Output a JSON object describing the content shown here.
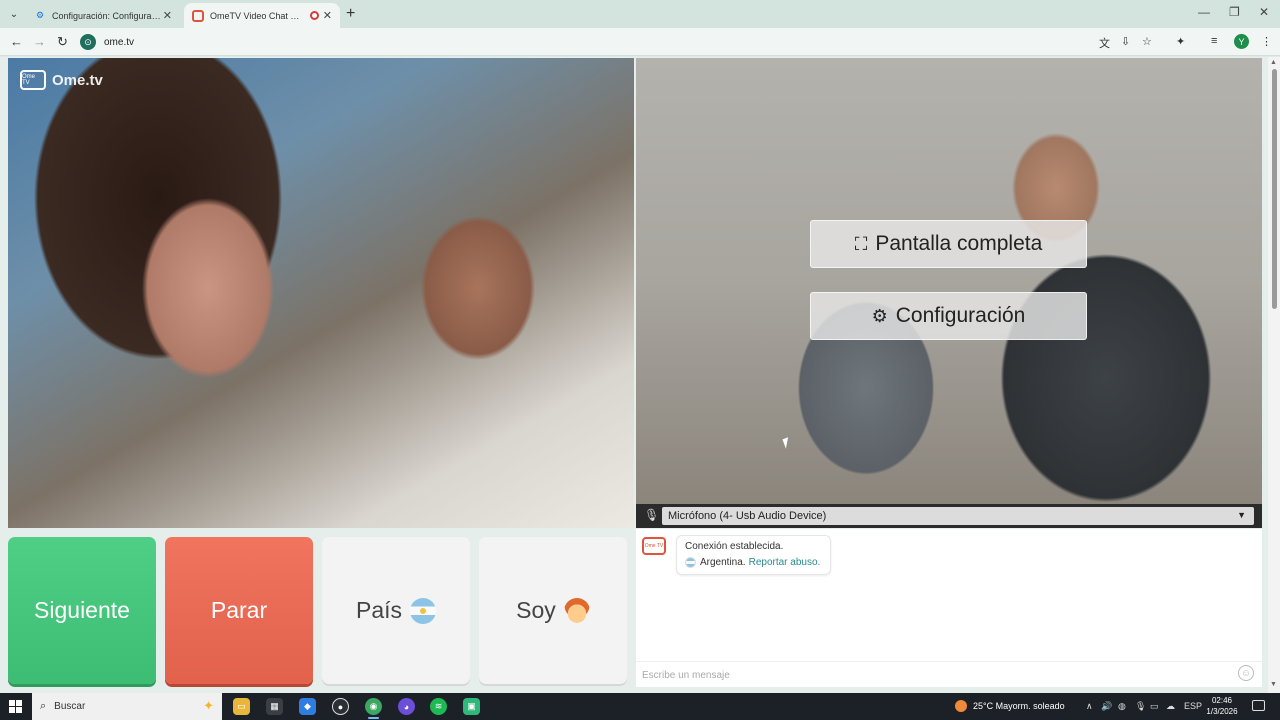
{
  "browser": {
    "tabs": [
      {
        "title": "Configuración: Configuración d…",
        "favicon": "gear-icon",
        "active": false
      },
      {
        "title": "OmeTV Video Chat — Ome",
        "favicon": "ometv-icon",
        "active": true,
        "recording": true
      }
    ],
    "url": "ome.tv"
  },
  "video": {
    "logo_box": "Ome TV",
    "logo_text": "Ome.tv",
    "fullscreen_label": "Pantalla completa",
    "settings_label": "Configuración",
    "microphone": "Micrófono (4- Usb Audio Device)"
  },
  "controls": {
    "next_label": "Siguiente",
    "stop_label": "Parar",
    "country_label": "País",
    "gender_label": "Soy"
  },
  "chat": {
    "icon_label": "Ome TV",
    "status": "Conexión establecida.",
    "country": "Argentina.",
    "report_link": "Reportar abuso.",
    "input_placeholder": "Escribe un mensaje"
  },
  "taskbar": {
    "search_placeholder": "Buscar",
    "weather": "25°C  Mayorm. soleado",
    "language": "ESP",
    "time": "02:46",
    "date": "1/3/2026"
  },
  "colors": {
    "next": "#3dbd74",
    "stop": "#e2624c",
    "link": "#2a8a8f"
  }
}
